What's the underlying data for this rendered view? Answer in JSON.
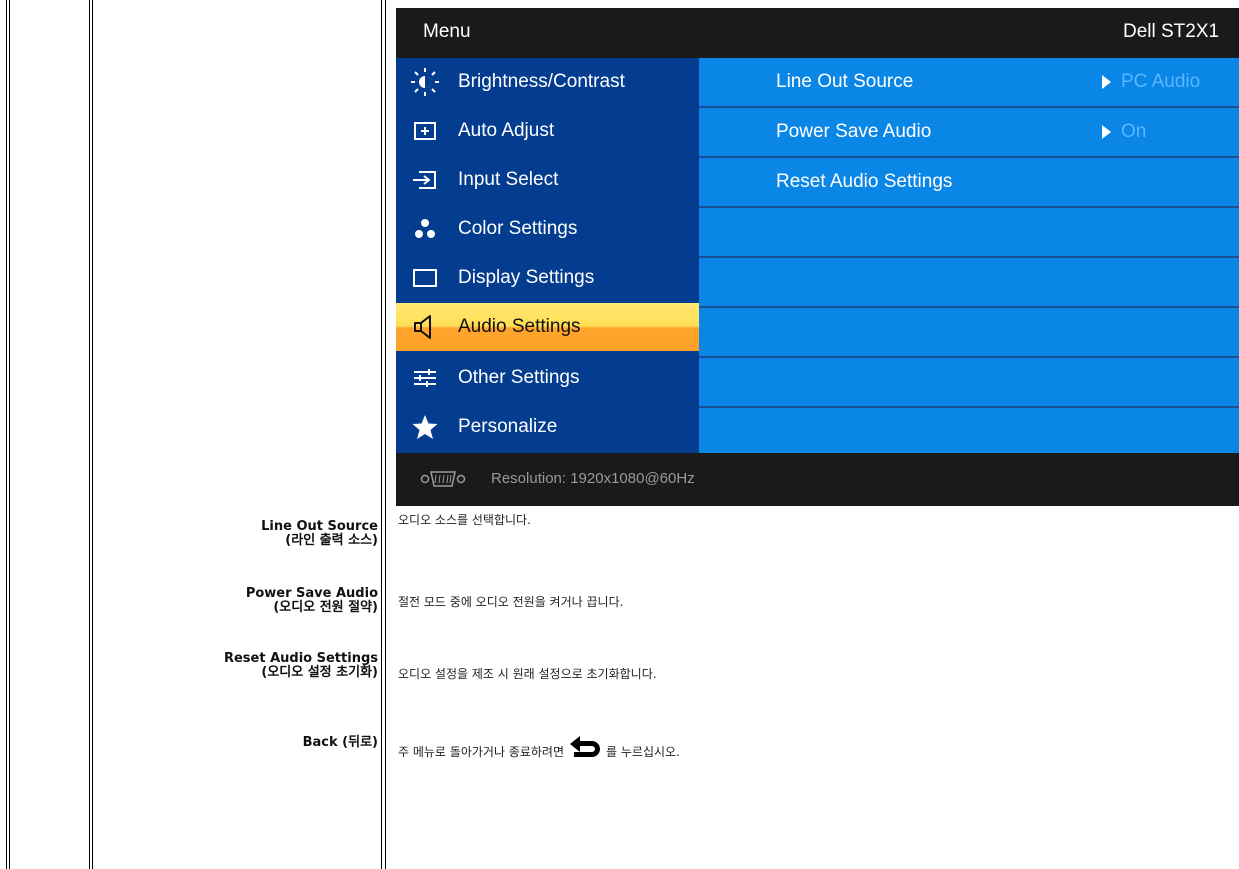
{
  "osd": {
    "menu_title": "Menu",
    "model": "Dell ST2X1",
    "menu_items": [
      {
        "label": "Brightness/Contrast",
        "icon": "brightness-icon"
      },
      {
        "label": "Auto Adjust",
        "icon": "auto-adjust-icon"
      },
      {
        "label": "Input Select",
        "icon": "input-select-icon"
      },
      {
        "label": "Color Settings",
        "icon": "color-settings-icon"
      },
      {
        "label": "Display Settings",
        "icon": "display-settings-icon"
      },
      {
        "label": "Audio Settings",
        "icon": "speaker-icon",
        "selected": true
      },
      {
        "label": "Other Settings",
        "icon": "sliders-icon"
      },
      {
        "label": "Personalize",
        "icon": "star-icon"
      }
    ],
    "sub_items": [
      {
        "label": "Line Out Source",
        "value": "PC Audio"
      },
      {
        "label": "Power Save Audio",
        "value": "On"
      },
      {
        "label": "Reset Audio Settings",
        "value": ""
      }
    ],
    "footer_resolution": "Resolution:  1920x1080@60Hz",
    "colors": {
      "header_bg": "#1a1a1a",
      "menu_bg": "#043d8f",
      "panel_bg": "#0a86e6",
      "selected_top": "#ffe873",
      "selected_bottom": "#ff9f2a",
      "value_text": "#5ab6ff"
    }
  },
  "descriptions": [
    {
      "term": "Line Out Source",
      "term_ko": "(라인 출력 소스)",
      "text": "오디오 소스를 선택합니다."
    },
    {
      "term": "Power Save Audio",
      "term_ko": "(오디오 전원 절약)",
      "text": "절전 모드 중에 오디오 전원을 켜거나 끕니다."
    },
    {
      "term": "Reset Audio Settings",
      "term_ko": "(오디오 설정 초기화)",
      "text": "오디오 설정을 제조 시 원래 설정으로 초기화합니다."
    },
    {
      "term": "Back (뒤로)",
      "text_before": "주 메뉴로 돌아가거나 종료하려면",
      "text_after": "를 누르십시오.",
      "icon": "back-arrow-icon"
    }
  ]
}
